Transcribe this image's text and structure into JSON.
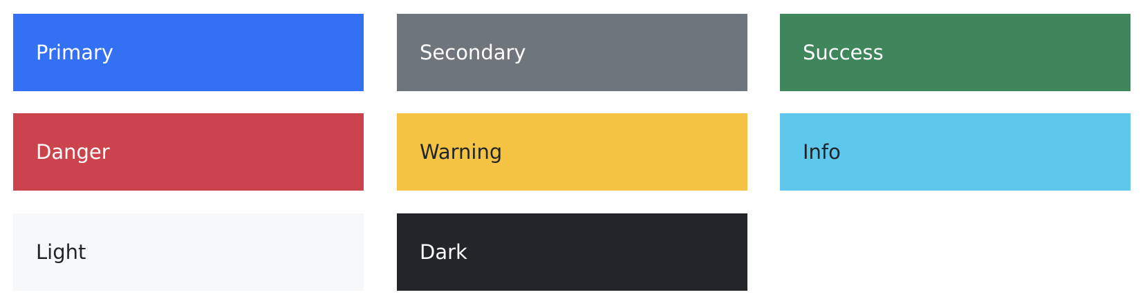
{
  "swatches": [
    {
      "label": "Primary",
      "bg": "#3470f3",
      "fg": "#ffffff"
    },
    {
      "label": "Secondary",
      "bg": "#6e757d",
      "fg": "#ffffff"
    },
    {
      "label": "Success",
      "bg": "#40865c",
      "fg": "#ffffff"
    },
    {
      "label": "Danger",
      "bg": "#cb444d",
      "fg": "#ffffff"
    },
    {
      "label": "Warning",
      "bg": "#f4c343",
      "fg": "#212529"
    },
    {
      "label": "Info",
      "bg": "#5dc7ec",
      "fg": "#212529"
    },
    {
      "label": "Light",
      "bg": "#f7f8fa",
      "fg": "#212529"
    },
    {
      "label": "Dark",
      "bg": "#232529",
      "fg": "#ffffff"
    }
  ]
}
